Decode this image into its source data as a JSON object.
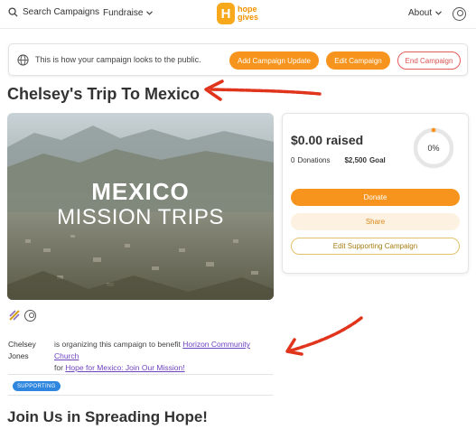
{
  "nav": {
    "search_label": "Search Campaigns",
    "fundraise_label": "Fundraise",
    "logo_mark": "H",
    "logo_text_1": "hope",
    "logo_text_2": "gives",
    "about_label": "About"
  },
  "preview": {
    "message": "This is how your campaign looks to the public.",
    "add_update_label": "Add Campaign Update",
    "edit_campaign_label": "Edit Campaign",
    "end_campaign_label": "End Campaign"
  },
  "campaign": {
    "title": "Chelsey's Trip To Mexico",
    "hero_line1": "MEXICO",
    "hero_line2": "MISSION TRIPS"
  },
  "card": {
    "raised": "$0.00 raised",
    "donations_count": "0",
    "donations_label": "Donations",
    "goal_amount": "$2,500",
    "goal_label": "Goal",
    "percent": "0%",
    "progress": 0,
    "donate_label": "Donate",
    "share_label": "Share",
    "edit_supporting_label": "Edit Supporting Campaign"
  },
  "organizer": {
    "name": "Chelsey Jones",
    "text_1": "is organizing this campaign to benefit",
    "org_link": "Horizon Community Church",
    "text_2": "for",
    "campaign_link": "Hope for Mexico: Join Our Mission!"
  },
  "badge": "SUPPORTING",
  "section_heading": "Join Us in Spreading Hope!",
  "colors": {
    "accent": "#f7941d",
    "danger": "#d9534f",
    "link": "#6f42c1",
    "badge": "#2e86de",
    "annotation_arrow": "#e0341c"
  }
}
